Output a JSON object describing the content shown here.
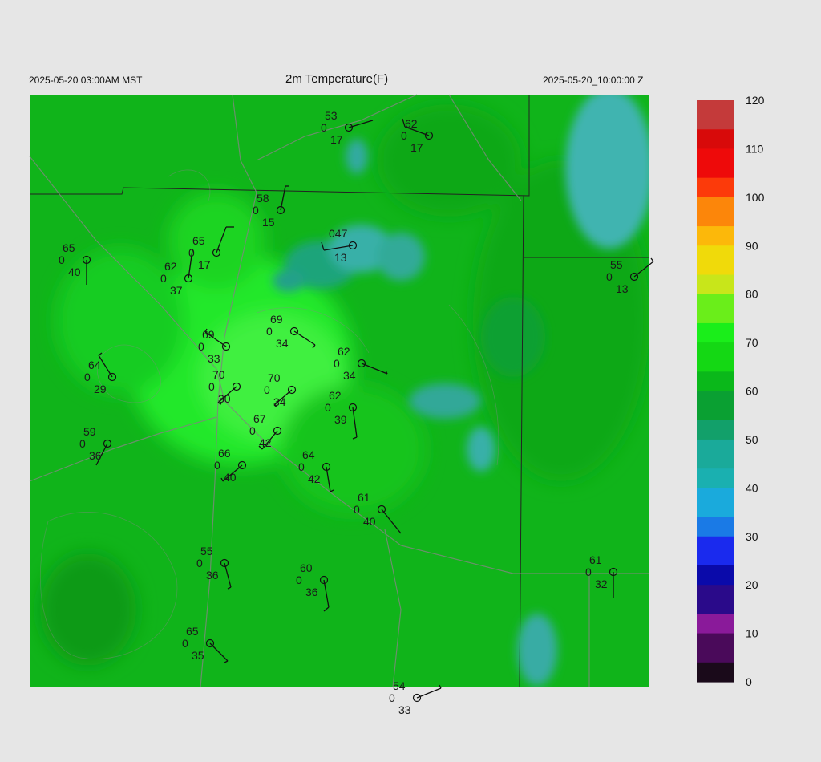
{
  "header": {
    "local_time": "2025-05-20 03:00AM MST",
    "title": "2m Temperature(F)",
    "valid_time": "2025-05-20_10:00:00 Z"
  },
  "colorbar": {
    "labels": [
      "0",
      "10",
      "20",
      "30",
      "40",
      "50",
      "60",
      "70",
      "80",
      "90",
      "100",
      "110",
      "120"
    ],
    "stops": [
      {
        "v": 0,
        "c": "#1a0a1a"
      },
      {
        "v": 5,
        "c": "#4a0a5a"
      },
      {
        "v": 10,
        "c": "#8a1a9a"
      },
      {
        "v": 15,
        "c": "#2a0a8a"
      },
      {
        "v": 20,
        "c": "#0a0aaa"
      },
      {
        "v": 25,
        "c": "#1a2aee"
      },
      {
        "v": 30,
        "c": "#1a7ae6"
      },
      {
        "v": 35,
        "c": "#1aaadc"
      },
      {
        "v": 40,
        "c": "#1ab0b0"
      },
      {
        "v": 45,
        "c": "#1aaa9a"
      },
      {
        "v": 50,
        "c": "#12a06a"
      },
      {
        "v": 55,
        "c": "#0aa032"
      },
      {
        "v": 60,
        "c": "#0ab81a"
      },
      {
        "v": 65,
        "c": "#14d814"
      },
      {
        "v": 70,
        "c": "#1aee1a"
      },
      {
        "v": 75,
        "c": "#6aee1a"
      },
      {
        "v": 80,
        "c": "#c8e61a"
      },
      {
        "v": 85,
        "c": "#f0da0a"
      },
      {
        "v": 90,
        "c": "#fcb80a"
      },
      {
        "v": 95,
        "c": "#fc860a"
      },
      {
        "v": 100,
        "c": "#fc3a0a"
      },
      {
        "v": 105,
        "c": "#ee0a0a"
      },
      {
        "v": 110,
        "c": "#d80a0a"
      },
      {
        "v": 115,
        "c": "#c43a3a"
      },
      {
        "v": 120,
        "c": "#d8d0d0"
      }
    ]
  },
  "stations": [
    {
      "t": "53",
      "m": "0",
      "d": "17"
    },
    {
      "t": "62",
      "m": "0",
      "d": "17"
    },
    {
      "t": "58",
      "m": "0",
      "d": "15"
    },
    {
      "t": "047",
      "m": "",
      "d": "13"
    },
    {
      "t": "65",
      "m": "0",
      "d": "17"
    },
    {
      "t": "62",
      "m": "0",
      "d": "37"
    },
    {
      "t": "65",
      "m": "0",
      "d": "40"
    },
    {
      "t": "55",
      "m": "0",
      "d": "13"
    },
    {
      "t": "69",
      "m": "0",
      "d": "34"
    },
    {
      "t": "69",
      "m": "0",
      "d": "33"
    },
    {
      "t": "62",
      "m": "0",
      "d": "34"
    },
    {
      "t": "64",
      "m": "0",
      "d": "29"
    },
    {
      "t": "70",
      "m": "0",
      "d": "30"
    },
    {
      "t": "70",
      "m": "0",
      "d": "34"
    },
    {
      "t": "62",
      "m": "0",
      "d": "39"
    },
    {
      "t": "67",
      "m": "0",
      "d": "42"
    },
    {
      "t": "59",
      "m": "0",
      "d": "36"
    },
    {
      "t": "66",
      "m": "0",
      "d": "40"
    },
    {
      "t": "64",
      "m": "0",
      "d": "42"
    },
    {
      "t": "61",
      "m": "0",
      "d": "40"
    },
    {
      "t": "55",
      "m": "0",
      "d": "36"
    },
    {
      "t": "60",
      "m": "0",
      "d": "36"
    },
    {
      "t": "61",
      "m": "0",
      "d": "32"
    },
    {
      "t": "65",
      "m": "0",
      "d": "35"
    },
    {
      "t": "54",
      "m": "0",
      "d": "33"
    }
  ]
}
